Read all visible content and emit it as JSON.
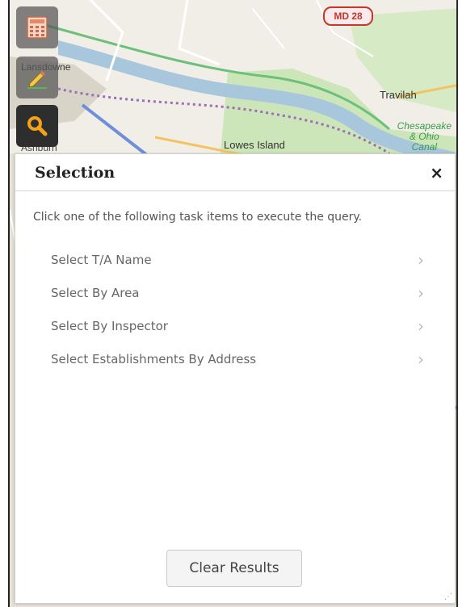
{
  "map": {
    "route_shield": "MD 28",
    "labels": {
      "lansdowne": "Lansdowne",
      "travilah": "Travilah",
      "lowes_island": "Lowes Island",
      "ashburn": "Ashburn",
      "canal_line1": "Chesapeake",
      "canal_line2": "& Ohio",
      "canal_line3": "Canal"
    }
  },
  "toolbar": {
    "tools": [
      {
        "icon": "calculator-icon"
      },
      {
        "icon": "edit-pencil-icon"
      },
      {
        "icon": "search-icon",
        "active": true
      }
    ]
  },
  "panel": {
    "title": "Selection",
    "close_label": "×",
    "instructions": "Click one of the following task items to execute the query.",
    "tasks": [
      {
        "label": "Select T/A Name"
      },
      {
        "label": "Select By Area"
      },
      {
        "label": "Select By Inspector"
      },
      {
        "label": "Select Establishments By Address"
      }
    ],
    "clear_button": "Clear Results"
  },
  "colors": {
    "accent": "#f5a21b",
    "route_red": "#c0392b",
    "river": "#a9c7dc",
    "park_green": "#b5dca0"
  }
}
